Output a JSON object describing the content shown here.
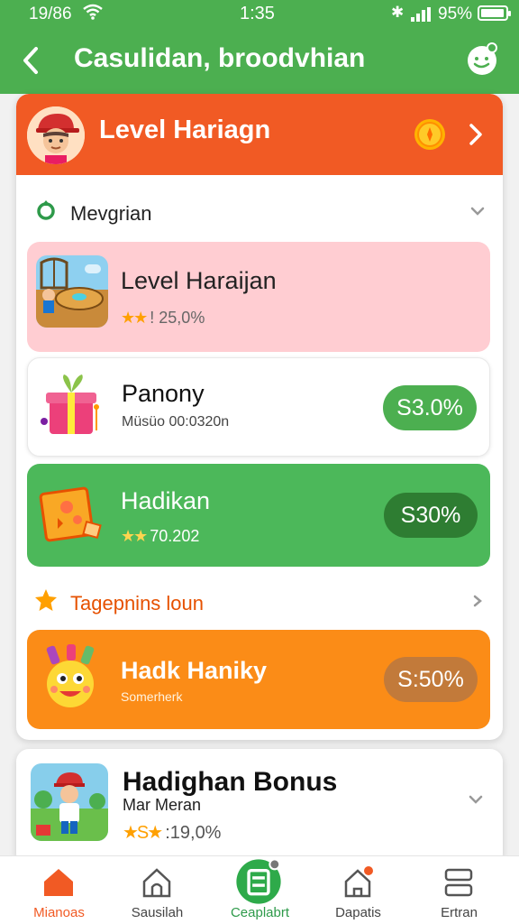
{
  "status_bar": {
    "left_text": "19/86",
    "time": "1:35",
    "battery_text": "95%",
    "battery_level": 0.95
  },
  "header": {
    "title": "Casulidan, broodvhian"
  },
  "level_card": {
    "title": "Level Hariagn"
  },
  "section1": {
    "label": "Mevgrian"
  },
  "items": [
    {
      "name": "Level Haraijan",
      "stars": "★★",
      "meta": "! 25,0%"
    },
    {
      "name": "Panony",
      "sub": "Müsüo 00:0320n",
      "pill": "S3.0%"
    },
    {
      "name": "Hadikan",
      "stars": "★★",
      "meta": "70.202",
      "pill": "S30%"
    },
    {
      "name": "Hadk Haniky",
      "sub": "Somerherk",
      "pill": "S:50%"
    }
  ],
  "section2": {
    "label": "Tagepnins loun"
  },
  "bonus": {
    "name": "Hadighan Bonus",
    "sub": "Mar Meran",
    "stars": "★S★",
    "meta": ":19,0%"
  },
  "nav": [
    {
      "label": "Mianoas",
      "icon": "home-icon"
    },
    {
      "label": "Sausilah",
      "icon": "house-outline-icon"
    },
    {
      "label": "Ceaplabrt",
      "icon": "list-icon"
    },
    {
      "label": "Dapatis",
      "icon": "notification-home-icon"
    },
    {
      "label": "Ertran",
      "icon": "menu-icon"
    }
  ],
  "colors": {
    "header_green": "#4caf50",
    "level_orange": "#f15a24",
    "item_pink": "#ffcdd2",
    "item_green": "#4cb85a",
    "item_orange": "#fb8c17",
    "active_nav": "#f15a24"
  }
}
